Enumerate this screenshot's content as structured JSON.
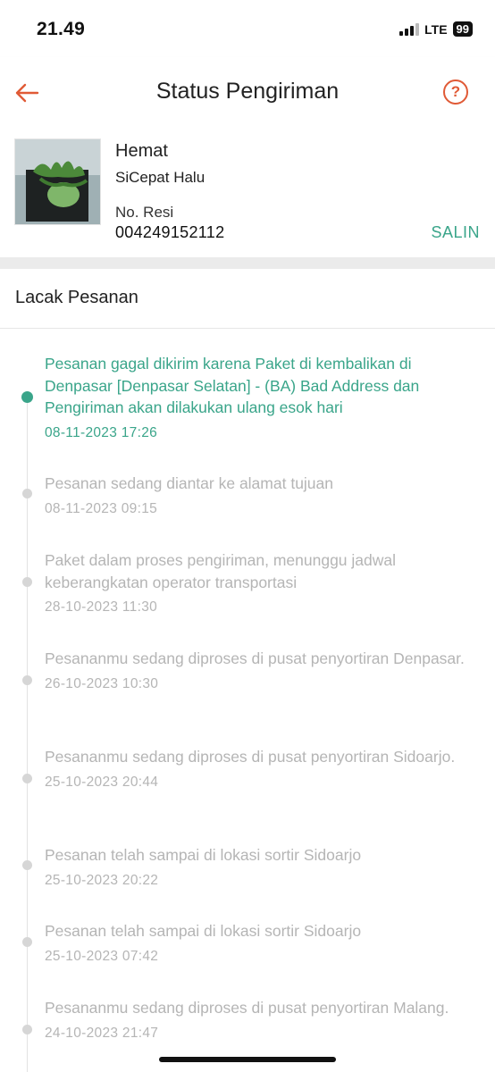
{
  "status_bar": {
    "time": "21.49",
    "network": "LTE",
    "battery": "99"
  },
  "header": {
    "title": "Status Pengiriman"
  },
  "product": {
    "name": "Hemat",
    "courier": "SiCepat Halu",
    "resi_label": "No. Resi",
    "resi_number": "004249152112",
    "copy_label": "SALIN"
  },
  "tracking": {
    "title": "Lacak Pesanan",
    "events": [
      {
        "desc": "Pesanan gagal dikirim karena Paket di kembalikan di Denpasar [Denpasar Selatan] - (BA) Bad Address dan Pengiriman akan dilakukan ulang esok hari",
        "time": "08-11-2023 17:26"
      },
      {
        "desc": "Pesanan sedang diantar ke alamat tujuan",
        "time": "08-11-2023 09:15"
      },
      {
        "desc": "Paket dalam proses pengiriman, menunggu jadwal keberangkatan operator transportasi",
        "time": "28-10-2023 11:30"
      },
      {
        "desc": "Pesananmu sedang diproses di pusat penyortiran Denpasar.",
        "time": "26-10-2023 10:30"
      },
      {
        "desc": "Pesananmu sedang diproses di pusat penyortiran Sidoarjo.",
        "time": "25-10-2023 20:44"
      },
      {
        "desc": "Pesanan telah sampai di lokasi sortir Sidoarjo",
        "time": "25-10-2023 20:22"
      },
      {
        "desc": "Pesanan telah sampai di lokasi sortir Sidoarjo",
        "time": "25-10-2023 07:42"
      },
      {
        "desc": "Pesananmu sedang diproses di pusat penyortiran Malang.",
        "time": "24-10-2023 21:47"
      }
    ]
  },
  "colors": {
    "accent": "#3aa58a",
    "brand": "#e05a36",
    "muted": "#b5b5b5"
  },
  "icons": {
    "back": "arrow-left-icon",
    "help": "question-circle-icon",
    "signal": "signal-icon"
  }
}
